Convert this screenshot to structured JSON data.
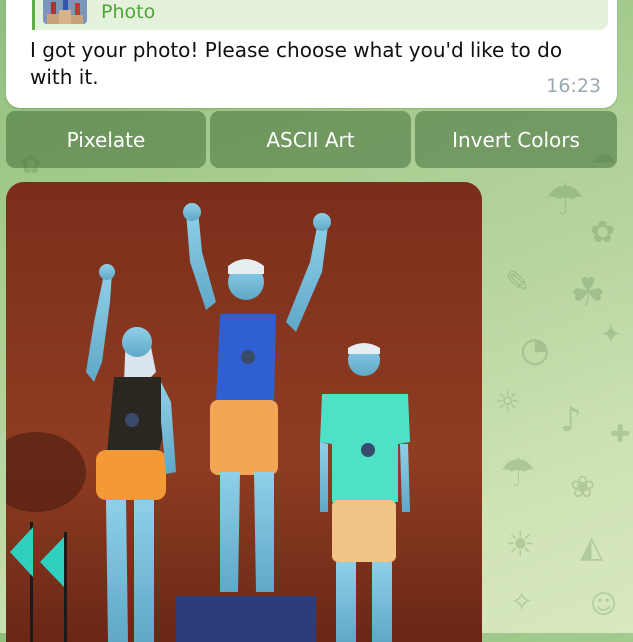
{
  "reply": {
    "title": "",
    "subtitle": "Photo"
  },
  "message": {
    "text": "I got your photo! Please choose what you'd like to do with it.",
    "time": "16:23"
  },
  "keyboard": {
    "buttons": [
      "Pixelate",
      "ASCII Art",
      "Invert Colors"
    ]
  },
  "photo": {
    "description_icon": "inverted-photo-of-athletes-on-podium"
  },
  "colors": {
    "accent": "#4ea63a",
    "bubble": "#ffffff",
    "button": "#4a743e"
  }
}
